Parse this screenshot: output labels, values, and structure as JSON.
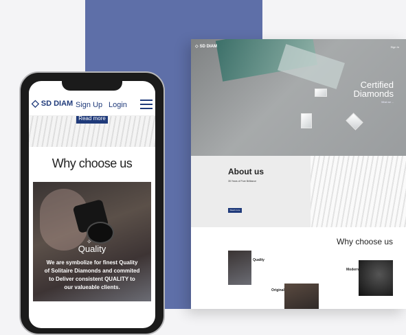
{
  "desktop": {
    "brand": "SD DIAM",
    "signin": "Sign In",
    "hero_title_line1": "Certified",
    "hero_title_line2": "Diamonds",
    "hero_subtitle": "What we ...",
    "about_title": "About us",
    "about_subtitle": "35 Years of Pure Brilliance",
    "about_button": "Read more",
    "why_title": "Why choose us",
    "why_cards": [
      {
        "caption": "Quality"
      },
      {
        "caption": "Original"
      },
      {
        "caption": "Modern"
      }
    ]
  },
  "mobile": {
    "brand": "SD DIAM",
    "brand_sub": "",
    "nav_signup": "Sign Up",
    "nav_login": "Login",
    "read_more": "Read more",
    "why_title": "Why choose us",
    "card_title": "Quality",
    "card_text": "We are symbolize for finest Quality of Solitaire Diamonds and commited to Deliver consistent QUALITY to our valueable clients."
  },
  "colors": {
    "accent": "#1f3a7a",
    "background_block": "#5e6fa8"
  }
}
